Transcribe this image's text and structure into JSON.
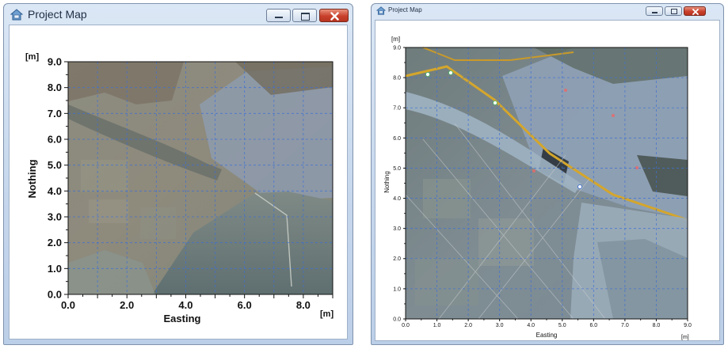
{
  "windows": [
    {
      "title": "Project Map",
      "x_axis": {
        "label": "Easting",
        "unit": "[m]",
        "ticks": [
          "0.0",
          "2.0",
          "4.0",
          "6.0",
          "8.0"
        ]
      },
      "y_axis": {
        "label": "Nothing",
        "unit": "[m]",
        "ticks": [
          "0.0",
          "1.0",
          "2.0",
          "3.0",
          "4.0",
          "5.0",
          "6.0",
          "7.0",
          "8.0",
          "9.0"
        ]
      },
      "map_layer": "satellite-image-before-development"
    },
    {
      "title": "Project Map",
      "x_axis": {
        "label": "Easting",
        "unit": "[m]",
        "ticks": [
          "0.0",
          "1.0",
          "2.0",
          "3.0",
          "4.0",
          "5.0",
          "6.0",
          "7.0",
          "8.0",
          "9.0"
        ]
      },
      "y_axis": {
        "label": "Nothing",
        "unit": "[m]",
        "ticks": [
          "0.0",
          "1.0",
          "2.0",
          "3.0",
          "4.0",
          "5.0",
          "6.0",
          "7.0",
          "8.0",
          "9.0"
        ]
      },
      "map_layer": "satellite-image-after-development"
    }
  ],
  "colors": {
    "titlebar": "#c5d6ec",
    "grid_line": "#3d6fd6",
    "close_button": "#c8412c"
  },
  "icons": [
    "map-app-icon",
    "minimize-icon",
    "maximize-icon",
    "close-icon"
  ]
}
